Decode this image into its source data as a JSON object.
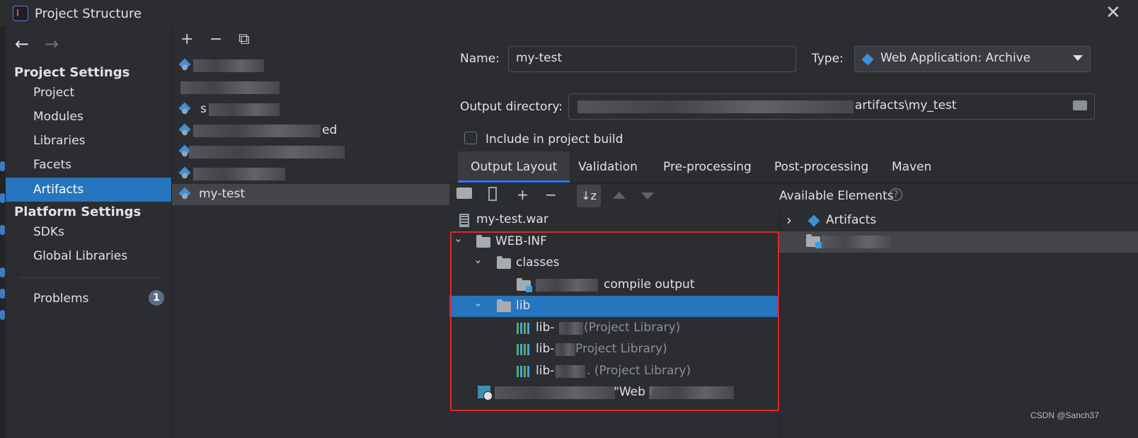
{
  "window": {
    "title": "Project Structure"
  },
  "sidebar": {
    "back_label": "←",
    "forward_label": "→",
    "project_settings_heading": "Project Settings",
    "project_items": [
      "Project",
      "Modules",
      "Libraries",
      "Facets",
      "Artifacts"
    ],
    "selected_item": "Artifacts",
    "platform_settings_heading": "Platform Settings",
    "platform_items": [
      "SDKs",
      "Global Libraries"
    ],
    "problems_label": "Problems",
    "problems_count": "1"
  },
  "artifact_list": {
    "toolbar": {
      "add": "+",
      "remove": "−",
      "copy": "⧉"
    },
    "items": [
      {
        "label": "",
        "redacted": true
      },
      {
        "label": "",
        "redacted": true
      },
      {
        "label": "s",
        "redacted": true
      },
      {
        "label": "ed",
        "redacted": true
      },
      {
        "label": "",
        "redacted": true
      },
      {
        "label": "",
        "redacted": true
      },
      {
        "label": "my-test",
        "redacted": false
      }
    ],
    "selected": "my-test"
  },
  "details": {
    "name_label": "Name:",
    "name_value": "my-test",
    "type_label": "Type:",
    "type_value": "Web Application: Archive",
    "output_dir_label": "Output directory:",
    "output_dir_value": "artifacts\\my_test",
    "include_build_label": "Include in project build",
    "include_build_checked": false
  },
  "tabs": [
    "Output Layout",
    "Validation",
    "Pre-processing",
    "Post-processing",
    "Maven"
  ],
  "active_tab": "Output Layout",
  "layout_toolbar": {
    "sort_label": "↓z"
  },
  "output_tree": {
    "root": "my-test.war",
    "web_inf": "WEB-INF",
    "classes": "classes",
    "compile_output": "compile output",
    "lib": "lib",
    "libs": [
      {
        "name": "lib-",
        "suffix": "(Project Library)"
      },
      {
        "name": "lib-",
        "suffix": "Project Library)"
      },
      {
        "name": "lib-",
        "suffix": ". (Project Library)"
      }
    ],
    "facet_text": "\"Web f"
  },
  "available": {
    "title": "Available Elements",
    "help": "?",
    "artifacts_label": "Artifacts"
  },
  "watermark": "CSDN @Sanch37",
  "colors": {
    "accent": "#2675bf",
    "highlight_box": "#e0272a",
    "tab_underline": "#3574f0"
  }
}
